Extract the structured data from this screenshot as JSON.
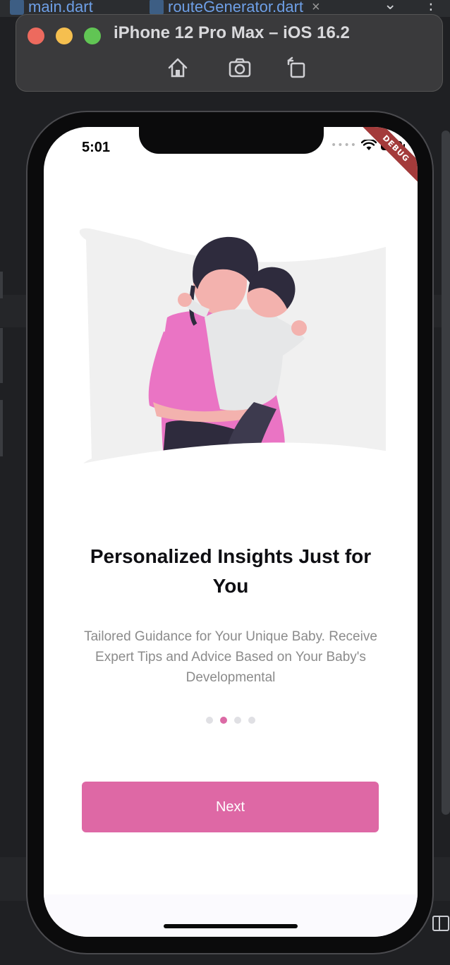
{
  "ide": {
    "tabs": [
      {
        "label": "main.dart"
      },
      {
        "label": "routeGenerator.dart",
        "close": "×"
      }
    ],
    "chevron": "⌄",
    "more": "⋮"
  },
  "simulator": {
    "title": "iPhone 12 Pro Max – iOS 16.2",
    "buttons": [
      "home-icon",
      "screenshot-icon",
      "rotate-icon"
    ],
    "traffic_colors": [
      "#ed6a5e",
      "#f5bf4f",
      "#61c554"
    ]
  },
  "status_bar": {
    "time": "5:01",
    "signal": "••••"
  },
  "debug_banner": "DEBUG",
  "onboarding": {
    "title": "Personalized Insights Just for You",
    "description": "Tailored Guidance for Your Unique Baby. Receive Expert Tips and Advice Based on Your Baby's Developmental",
    "page_indicator": {
      "count": 4,
      "active_index": 1
    },
    "next_label": "Next",
    "accent_color": "#de68a5"
  }
}
